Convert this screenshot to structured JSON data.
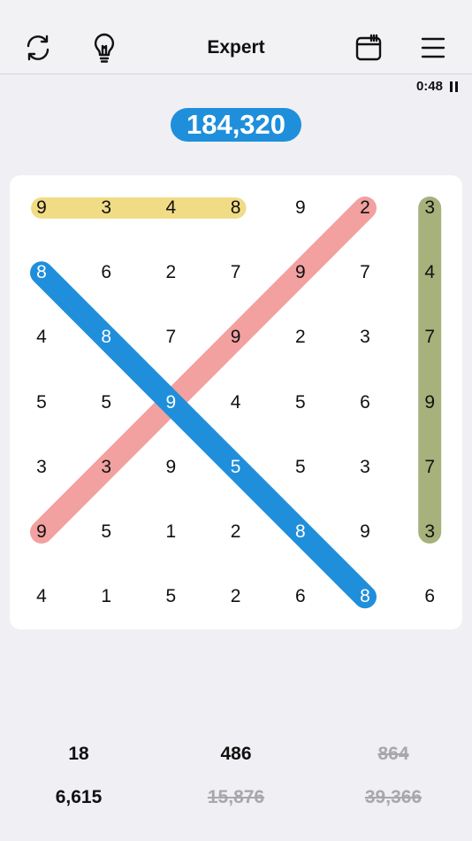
{
  "header": {
    "title": "Expert",
    "timer": "0:48",
    "icons": {
      "restart": "refresh-icon",
      "hint": "lightbulb-icon",
      "calendar": "calendar-icon",
      "menu": "menu-icon"
    }
  },
  "score": "184,320",
  "grid": [
    [
      "9",
      "3",
      "4",
      "8",
      "9",
      "2",
      "3"
    ],
    [
      "8",
      "6",
      "2",
      "7",
      "9",
      "7",
      "4"
    ],
    [
      "4",
      "8",
      "7",
      "9",
      "2",
      "3",
      "7"
    ],
    [
      "5",
      "5",
      "9",
      "4",
      "5",
      "6",
      "9"
    ],
    [
      "3",
      "3",
      "9",
      "5",
      "5",
      "3",
      "7"
    ],
    [
      "9",
      "5",
      "1",
      "2",
      "8",
      "9",
      "3"
    ],
    [
      "4",
      "1",
      "5",
      "2",
      "6",
      "8",
      "6"
    ]
  ],
  "found_words": [
    {
      "color": "#f1dc86",
      "from": [
        0,
        0
      ],
      "to": [
        0,
        3
      ]
    },
    {
      "color": "#f2a0a0",
      "from": [
        5,
        0
      ],
      "to": [
        0,
        5
      ]
    },
    {
      "color": "#a6b17c",
      "from": [
        0,
        6
      ],
      "to": [
        5,
        6
      ]
    },
    {
      "color": "#1f8fdb",
      "from": [
        1,
        0
      ],
      "to": [
        6,
        5
      ]
    }
  ],
  "targets": [
    [
      {
        "value": "18",
        "done": false
      },
      {
        "value": "486",
        "done": false
      },
      {
        "value": "864",
        "done": true
      }
    ],
    [
      {
        "value": "6,615",
        "done": false
      },
      {
        "value": "15,876",
        "done": true
      },
      {
        "value": "39,366",
        "done": true
      }
    ]
  ]
}
